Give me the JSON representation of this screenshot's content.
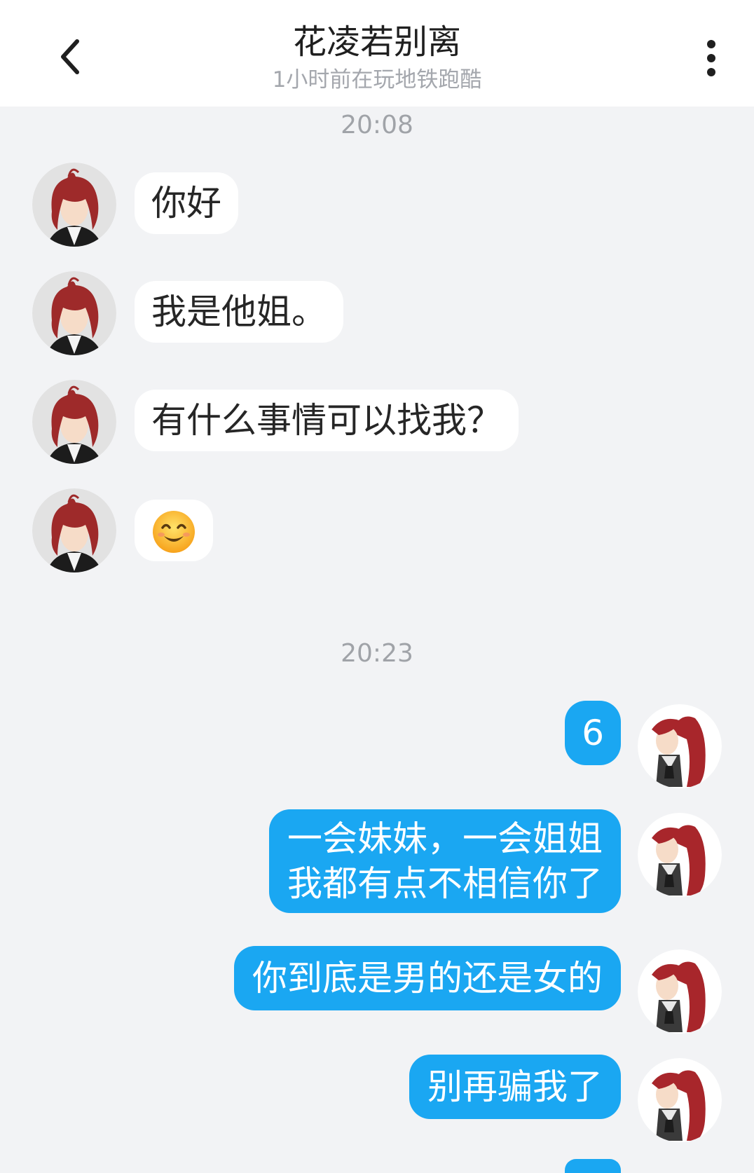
{
  "header": {
    "title": "花凌若别离",
    "status": "1小时前在玩地铁跑酷",
    "back_icon": "chevron-left-icon",
    "more_icon": "more-vertical-icon"
  },
  "timestamps": [
    "20:08",
    "20:23"
  ],
  "incoming": [
    {
      "text": "你好"
    },
    {
      "text": "我是他姐。"
    },
    {
      "text": "有什么事情可以找我？"
    },
    {
      "text": "",
      "emoji": "smiling-face-emoji"
    }
  ],
  "outgoing": [
    {
      "lines": [
        "6"
      ]
    },
    {
      "lines": [
        "一会妹妹，一会姐姐",
        "我都有点不相信你了"
      ]
    },
    {
      "lines": [
        "你到底是男的还是女的"
      ]
    },
    {
      "lines": [
        "别再骗我了"
      ]
    }
  ],
  "colors": {
    "background": "#f2f3f5",
    "outgoing_bubble": "#1aa7f2",
    "incoming_bubble": "#ffffff",
    "incoming_avatar_hair": "#9e2a2a",
    "outgoing_avatar_hair": "#a8262b"
  }
}
